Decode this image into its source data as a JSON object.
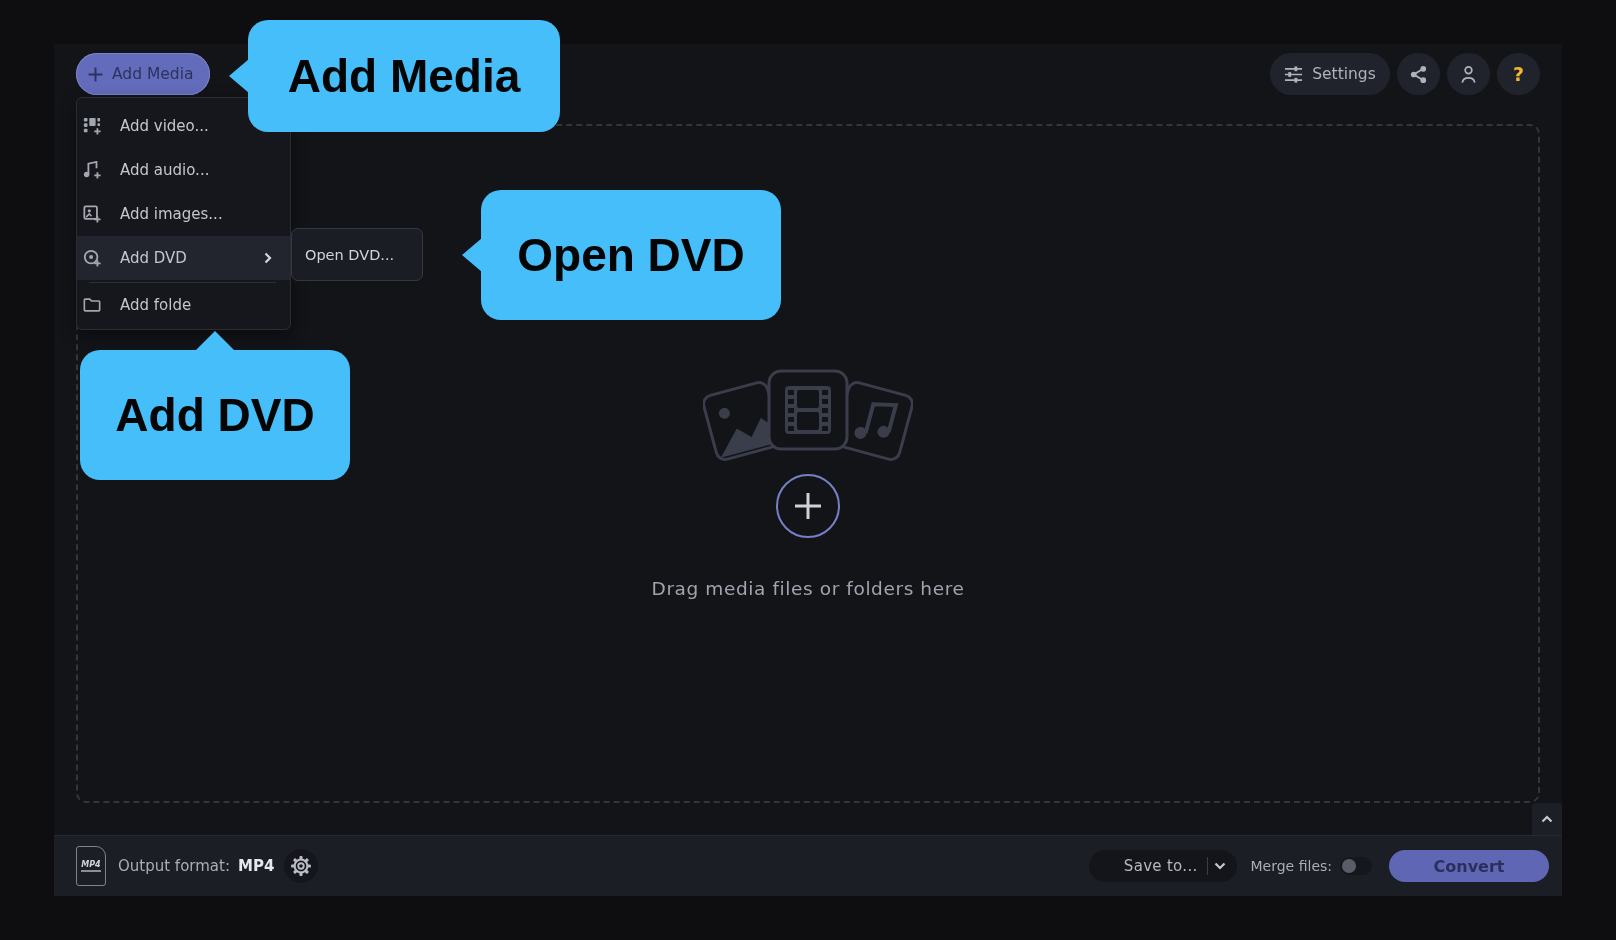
{
  "toolbar": {
    "add_media": {
      "label": "Add Media",
      "expanded": true
    },
    "settings": {
      "label": "Settings"
    },
    "help": {
      "label": "?"
    }
  },
  "add_media_menu": {
    "items": [
      {
        "kind": "video",
        "label": "Add video...",
        "selected": false,
        "has_submenu": false,
        "divider_above": false
      },
      {
        "kind": "audio",
        "label": "Add audio...",
        "selected": false,
        "has_submenu": false,
        "divider_above": false
      },
      {
        "kind": "images",
        "label": "Add images...",
        "selected": false,
        "has_submenu": false,
        "divider_above": false
      },
      {
        "kind": "dvd",
        "label": "Add DVD",
        "selected": true,
        "has_submenu": true,
        "divider_above": false
      },
      {
        "kind": "folder",
        "label": "Add folde",
        "selected": false,
        "has_submenu": false,
        "divider_above": true
      }
    ]
  },
  "submenu": {
    "items": [
      {
        "label": "Open DVD...",
        "selected": false
      }
    ]
  },
  "drop_zone": {
    "hint": "Drag media files or folders here"
  },
  "bottom_bar": {
    "format_badge": "MP4",
    "output_format_label": "Output format:",
    "output_format_value": "MP4",
    "save_to": {
      "label": "Save to..."
    },
    "merge_files": {
      "label": "Merge files:",
      "on": false
    },
    "convert": {
      "label": "Convert"
    }
  },
  "callouts": [
    {
      "kind": "left",
      "text": "Add Media"
    },
    {
      "kind": "left",
      "text": "Open DVD"
    },
    {
      "kind": "up",
      "text": "Add DVD"
    }
  ]
}
